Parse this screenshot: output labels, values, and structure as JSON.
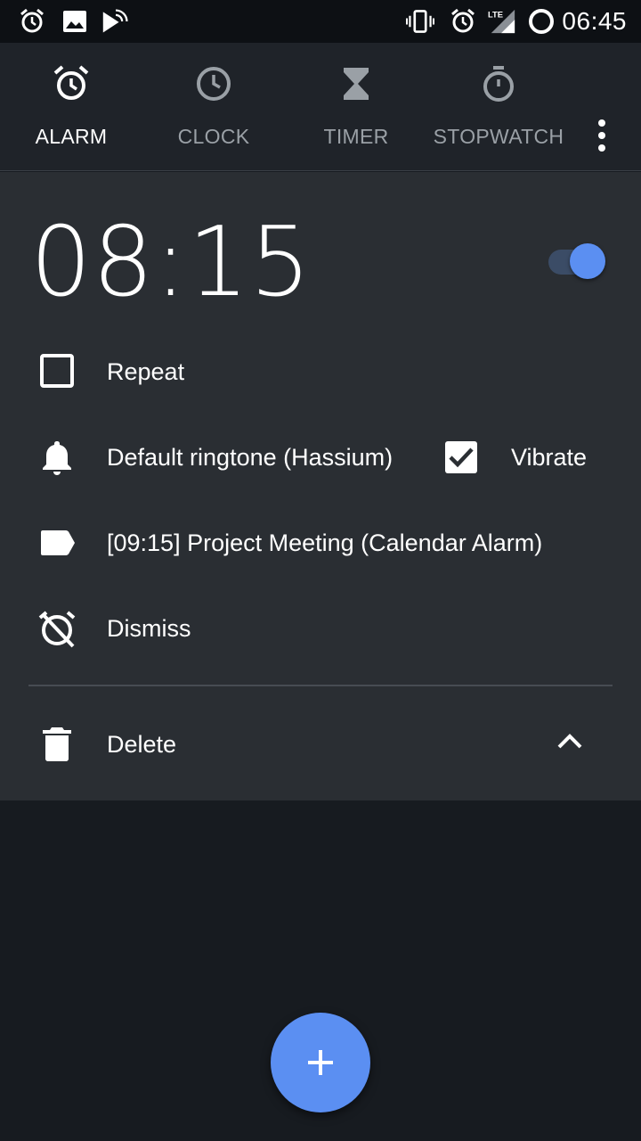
{
  "status_bar": {
    "time": "06:45",
    "left_icons": [
      "alarm-icon",
      "image-icon",
      "cast-icon"
    ],
    "right_icons": [
      "vibrate-icon",
      "alarm-icon",
      "lte-signal-icon",
      "battery-icon"
    ],
    "network_label": "LTE"
  },
  "tabs": [
    {
      "label": "ALARM",
      "icon": "alarm-icon",
      "active": true
    },
    {
      "label": "CLOCK",
      "icon": "clock-icon",
      "active": false
    },
    {
      "label": "TIMER",
      "icon": "hourglass-icon",
      "active": false
    },
    {
      "label": "STOPWATCH",
      "icon": "stopwatch-icon",
      "active": false
    }
  ],
  "alarm": {
    "time": "08:15",
    "enabled": true,
    "repeat_label": "Repeat",
    "repeat_checked": false,
    "ringtone_label": "Default ringtone (Hassium)",
    "vibrate_label": "Vibrate",
    "vibrate_checked": true,
    "alarm_label": "[09:15] Project Meeting (Calendar Alarm)",
    "dismiss_label": "Dismiss",
    "delete_label": "Delete"
  },
  "colors": {
    "accent": "#5b8ff2",
    "card_background": "#2a2e33",
    "page_background": "#171b20",
    "tab_bar_background": "#1f2329"
  }
}
